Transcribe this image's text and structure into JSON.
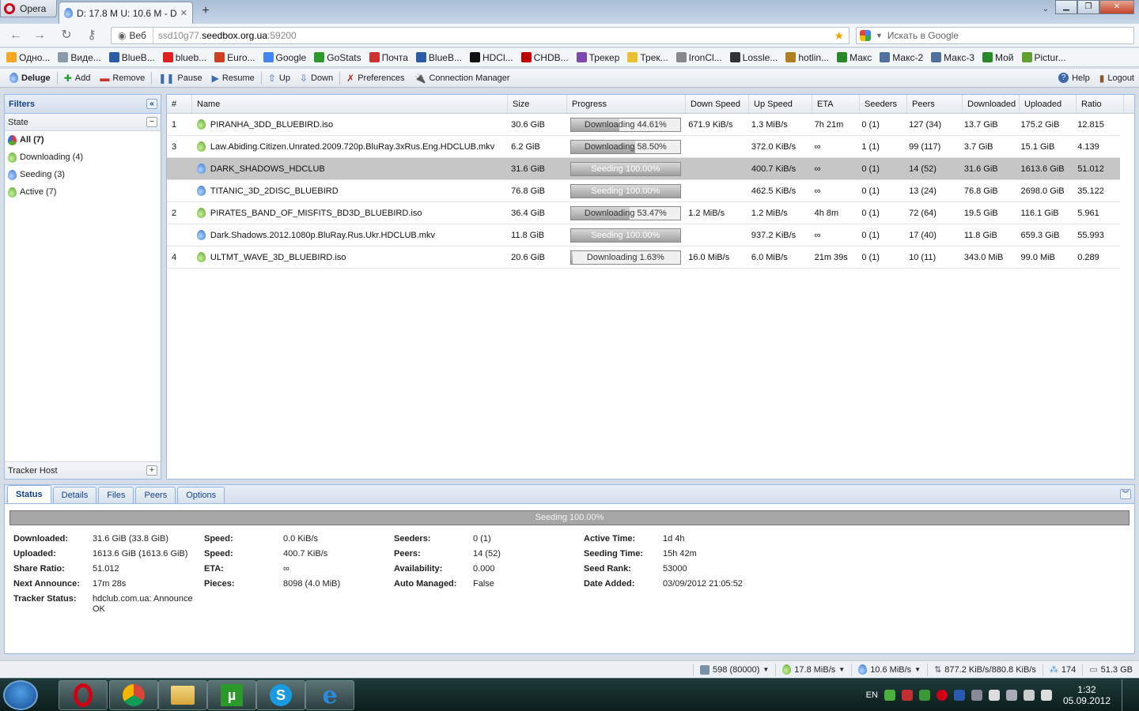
{
  "browser": {
    "menu_label": "Opera",
    "tab_title": "D: 17.8 M U: 10.6 M - D...",
    "address_prefix": "Веб",
    "address_host_pre": "ssd10g77.",
    "address_host": "seedbox.org.ua",
    "address_port": ":59200",
    "search_placeholder": "Искать в Google",
    "bookmarks": [
      {
        "label": "Одно...",
        "color": "#f5a623"
      },
      {
        "label": "Виде...",
        "color": "#8a9aa8"
      },
      {
        "label": "BlueB...",
        "color": "#2a5ca8"
      },
      {
        "label": "blueb...",
        "color": "#e02020"
      },
      {
        "label": "Euro...",
        "color": "#d04020"
      },
      {
        "label": "Google",
        "color": "#4285f4"
      },
      {
        "label": "GoStats",
        "color": "#2a9a2a"
      },
      {
        "label": "Почта",
        "color": "#d03030"
      },
      {
        "label": "BlueB...",
        "color": "#2a5ca8"
      },
      {
        "label": "HDCl...",
        "color": "#111111"
      },
      {
        "label": "CHDB...",
        "color": "#c00000"
      },
      {
        "label": "Трекер",
        "color": "#7a4ab0"
      },
      {
        "label": "Трек...",
        "color": "#e8c030"
      },
      {
        "label": "IronCl...",
        "color": "#888888"
      },
      {
        "label": "Lossle...",
        "color": "#333333"
      },
      {
        "label": "hotlin...",
        "color": "#b08020"
      },
      {
        "label": "Макс",
        "color": "#2a8a2a"
      },
      {
        "label": "Макс-2",
        "color": "#5070a0"
      },
      {
        "label": "Макс-3",
        "color": "#5070a0"
      },
      {
        "label": "Мой",
        "color": "#2a8a2a"
      },
      {
        "label": "Pictur...",
        "color": "#60a030"
      }
    ]
  },
  "toolbar": {
    "app_name": "Deluge",
    "add": "Add",
    "remove": "Remove",
    "pause": "Pause",
    "resume": "Resume",
    "up": "Up",
    "down": "Down",
    "preferences": "Preferences",
    "connection_manager": "Connection Manager",
    "help": "Help",
    "logout": "Logout"
  },
  "filters": {
    "title": "Filters",
    "state_header": "State",
    "items": [
      {
        "label": "All (7)",
        "icon": "all"
      },
      {
        "label": "Downloading (4)",
        "icon": "downloading"
      },
      {
        "label": "Seeding (3)",
        "icon": "seeding"
      },
      {
        "label": "Active (7)",
        "icon": "active"
      }
    ],
    "tracker_host": "Tracker Host"
  },
  "columns": [
    "#",
    "Name",
    "Size",
    "Progress",
    "Down Speed",
    "Up Speed",
    "ETA",
    "Seeders",
    "Peers",
    "Downloaded",
    "Uploaded",
    "Ratio"
  ],
  "torrents": [
    {
      "num": "1",
      "name": "PIRANHA_3DD_BLUEBIRD.iso",
      "size": "30.6 GiB",
      "progress_text": "Downloading 44.61%",
      "progress": 44.61,
      "state": "downloading",
      "down": "671.9 KiB/s",
      "up": "1.3 MiB/s",
      "eta": "7h 21m",
      "seeders": "0 (1)",
      "peers": "127 (34)",
      "downloaded": "13.7 GiB",
      "uploaded": "175.2 GiB",
      "ratio": "12.815"
    },
    {
      "num": "3",
      "name": "Law.Abiding.Citizen.Unrated.2009.720p.BluRay.3xRus.Eng.HDCLUB.mkv",
      "size": "6.2 GiB",
      "progress_text": "Downloading 58.50%",
      "progress": 58.5,
      "state": "downloading",
      "down": "",
      "up": "372.0 KiB/s",
      "eta": "∞",
      "seeders": "1 (1)",
      "peers": "99 (117)",
      "downloaded": "3.7 GiB",
      "uploaded": "15.1 GiB",
      "ratio": "4.139"
    },
    {
      "num": "",
      "name": "DARK_SHADOWS_HDCLUB",
      "size": "31.6 GiB",
      "progress_text": "Seeding 100.00%",
      "progress": 100,
      "state": "seeding",
      "down": "",
      "up": "400.7 KiB/s",
      "eta": "∞",
      "seeders": "0 (1)",
      "peers": "14 (52)",
      "downloaded": "31.6 GiB",
      "uploaded": "1613.6 GiB",
      "ratio": "51.012",
      "selected": true
    },
    {
      "num": "",
      "name": "TITANIC_3D_2DISC_BLUEBIRD",
      "size": "76.8 GiB",
      "progress_text": "Seeding 100.00%",
      "progress": 100,
      "state": "seeding",
      "down": "",
      "up": "462.5 KiB/s",
      "eta": "∞",
      "seeders": "0 (1)",
      "peers": "13 (24)",
      "downloaded": "76.8 GiB",
      "uploaded": "2698.0 GiB",
      "ratio": "35.122"
    },
    {
      "num": "2",
      "name": "PIRATES_BAND_OF_MISFITS_BD3D_BLUEBIRD.iso",
      "size": "36.4 GiB",
      "progress_text": "Downloading 53.47%",
      "progress": 53.47,
      "state": "downloading",
      "down": "1.2 MiB/s",
      "up": "1.2 MiB/s",
      "eta": "4h 8m",
      "seeders": "0 (1)",
      "peers": "72 (64)",
      "downloaded": "19.5 GiB",
      "uploaded": "116.1 GiB",
      "ratio": "5.961"
    },
    {
      "num": "",
      "name": "Dark.Shadows.2012.1080p.BluRay.Rus.Ukr.HDCLUB.mkv",
      "size": "11.8 GiB",
      "progress_text": "Seeding 100.00%",
      "progress": 100,
      "state": "seeding",
      "down": "",
      "up": "937.2 KiB/s",
      "eta": "∞",
      "seeders": "0 (1)",
      "peers": "17 (40)",
      "downloaded": "11.8 GiB",
      "uploaded": "659.3 GiB",
      "ratio": "55.993"
    },
    {
      "num": "4",
      "name": "ULTMT_WAVE_3D_BLUEBIRD.iso",
      "size": "20.6 GiB",
      "progress_text": "Downloading 1.63%",
      "progress": 1.63,
      "state": "downloading",
      "down": "16.0 MiB/s",
      "up": "6.0 MiB/s",
      "eta": "21m 39s",
      "seeders": "0 (1)",
      "peers": "10 (11)",
      "downloaded": "343.0 MiB",
      "uploaded": "99.0 MiB",
      "ratio": "0.289"
    }
  ],
  "details": {
    "tabs": [
      "Status",
      "Details",
      "Files",
      "Peers",
      "Options"
    ],
    "status_bar_text": "Seeding 100.00%",
    "status_progress": 100,
    "fields": [
      [
        {
          "k": "Downloaded:",
          "v": "31.6 GiB (33.8 GiB)"
        },
        {
          "k": "Uploaded:",
          "v": "1613.6 GiB (1613.6 GiB)"
        },
        {
          "k": "Share Ratio:",
          "v": "51.012"
        },
        {
          "k": "Next Announce:",
          "v": "17m 28s"
        },
        {
          "k": "Tracker Status:",
          "v": "hdclub.com.ua: Announce OK"
        }
      ],
      [
        {
          "k": "Speed:",
          "v": "0.0 KiB/s"
        },
        {
          "k": "Speed:",
          "v": "400.7 KiB/s"
        },
        {
          "k": "ETA:",
          "v": "∞"
        },
        {
          "k": "Pieces:",
          "v": "8098 (4.0 MiB)"
        }
      ],
      [
        {
          "k": "Seeders:",
          "v": "0 (1)"
        },
        {
          "k": "Peers:",
          "v": "14 (52)"
        },
        {
          "k": "Availability:",
          "v": "0.000"
        },
        {
          "k": "Auto Managed:",
          "v": "False"
        }
      ],
      [
        {
          "k": "Active Time:",
          "v": "1d 4h"
        },
        {
          "k": "Seeding Time:",
          "v": "15h 42m"
        },
        {
          "k": "Seed Rank:",
          "v": "53000"
        },
        {
          "k": "Date Added:",
          "v": "03/09/2012 21:05:52"
        }
      ]
    ]
  },
  "statusbar": {
    "connections": "598 (80000)",
    "down_speed": "17.8 MiB/s",
    "up_speed": "10.6 MiB/s",
    "protocol": "877.2 KiB/s/880.8 KiB/s",
    "dht": "174",
    "free_space": "51.3 GB"
  },
  "taskbar": {
    "lang": "EN",
    "time": "1:32",
    "date": "05.09.2012"
  }
}
